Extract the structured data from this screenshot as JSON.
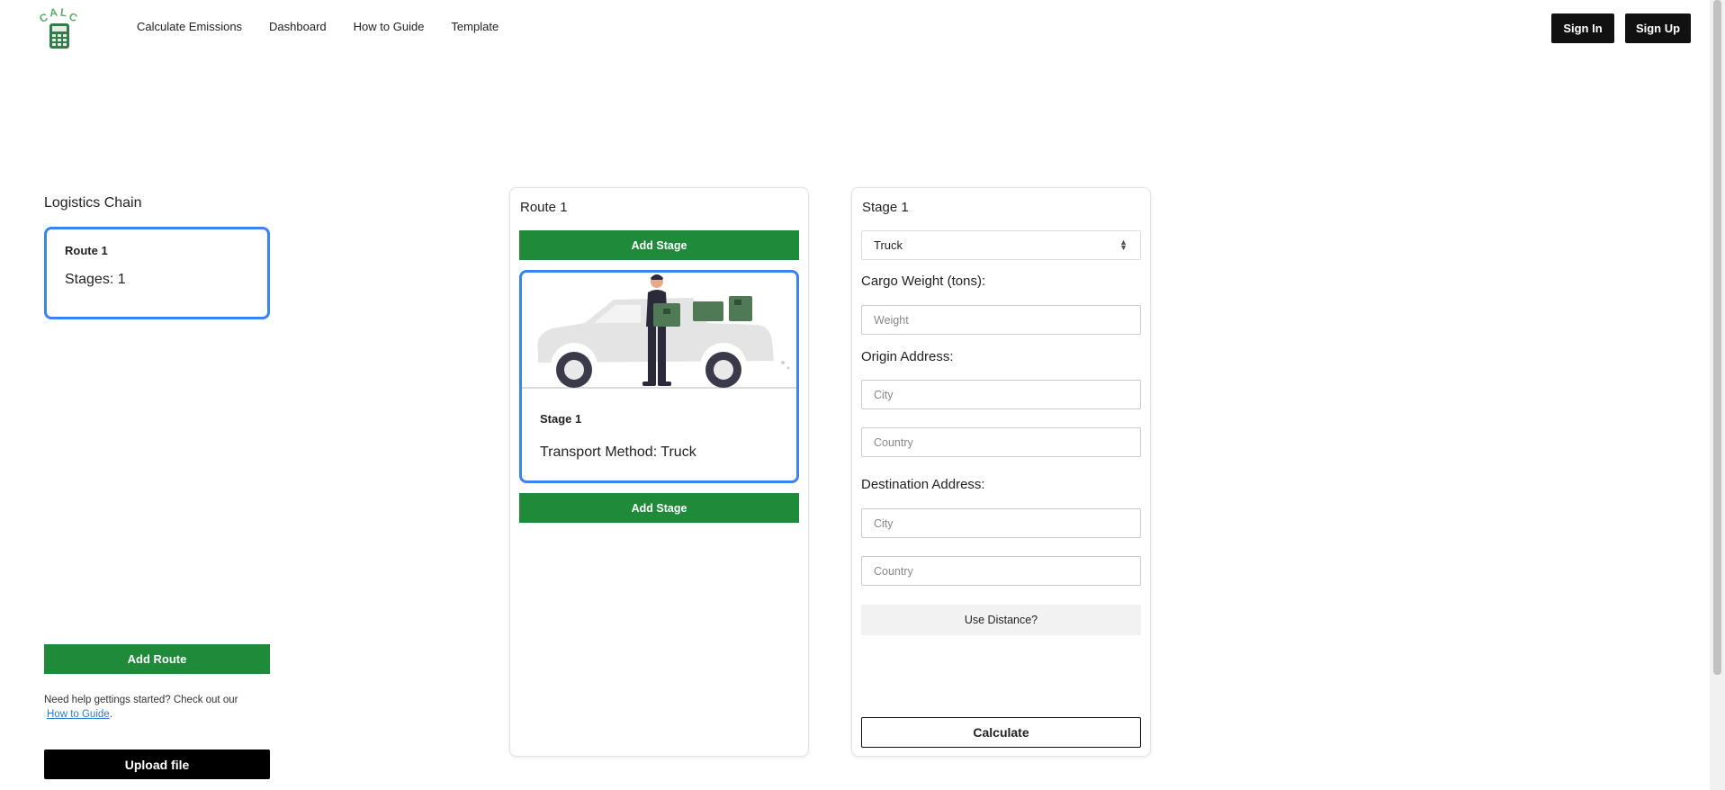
{
  "app": {
    "logo_text": "CALC",
    "brand_color": "#1e8a3a",
    "accent_color": "#3b82f6"
  },
  "header": {
    "nav": [
      "Calculate Emissions",
      "Dashboard",
      "How to Guide",
      "Template"
    ],
    "sign_in": "Sign In",
    "sign_up": "Sign Up"
  },
  "sidebar": {
    "title": "Logistics Chain",
    "routes": [
      {
        "name": "Route 1",
        "stages": "Stages: 1"
      }
    ],
    "add_route": "Add Route",
    "help_text": "Need help gettings started? Check out our",
    "help_link": "How to Guide",
    "help_suffix": ".",
    "upload": "Upload file"
  },
  "route_panel": {
    "title": "Route 1",
    "add_stage_top": "Add Stage",
    "add_stage_bottom": "Add Stage",
    "stage_card": {
      "name": "Stage 1",
      "method": "Transport Method: Truck",
      "illustration": "truck-delivery-illustration"
    }
  },
  "stage_panel": {
    "title": "Stage 1",
    "transport_select": "Truck",
    "cargo_label": "Cargo Weight (tons):",
    "cargo_placeholder": "Weight",
    "origin_label": "Origin Address:",
    "origin_city_placeholder": "City",
    "origin_country_placeholder": "Country",
    "destination_label": "Destination Address:",
    "destination_city_placeholder": "City",
    "destination_country_placeholder": "Country",
    "use_distance": "Use Distance?",
    "calculate": "Calculate"
  }
}
